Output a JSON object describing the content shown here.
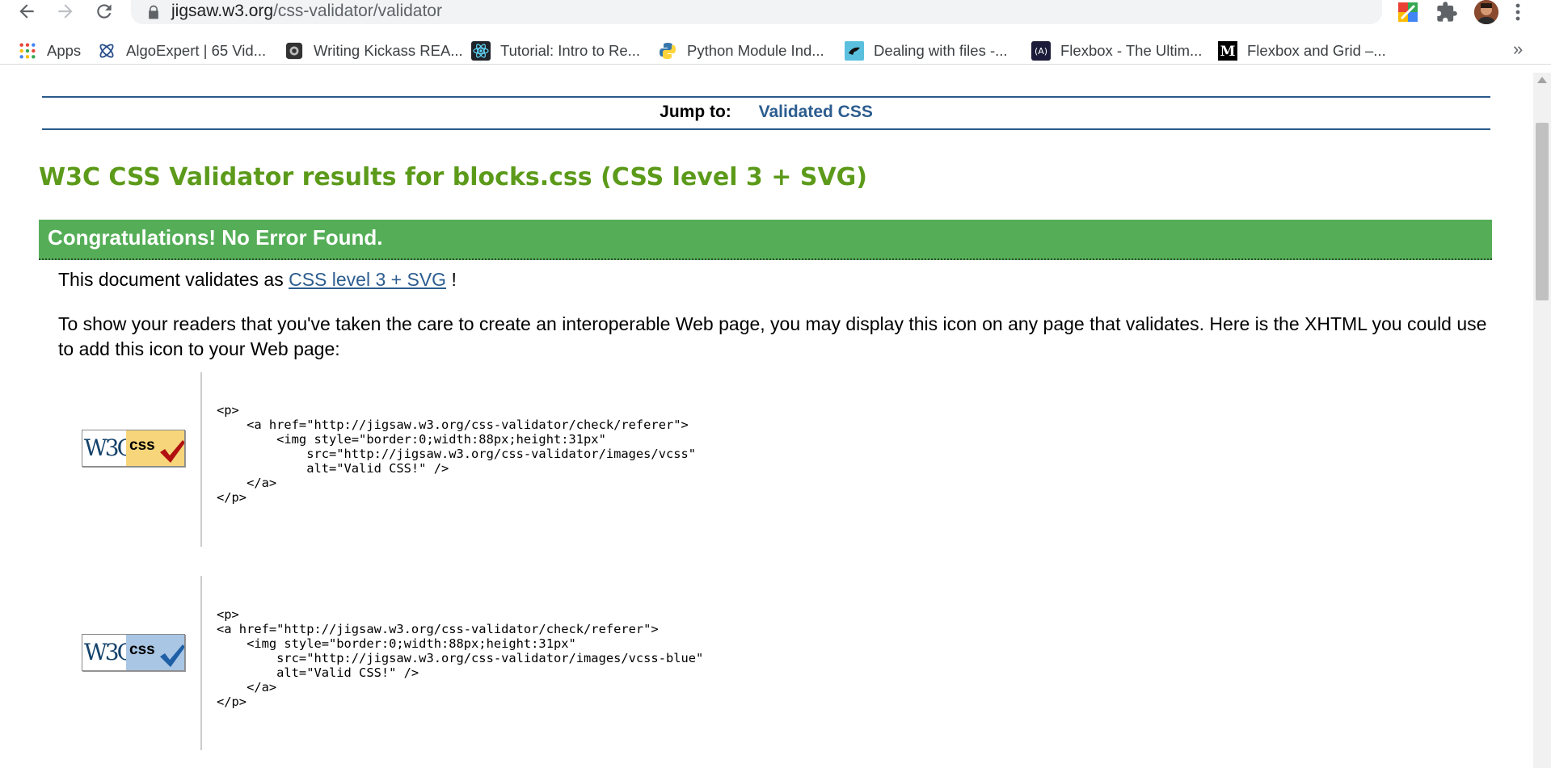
{
  "browser": {
    "url_host": "jigsaw.w3.org",
    "url_path": "/css-validator/validator"
  },
  "bookmarks": [
    {
      "label": "Apps",
      "icon": "apps-grid-icon"
    },
    {
      "label": "AlgoExpert | 65 Vid...",
      "icon": "algoexpert-icon"
    },
    {
      "label": "Writing Kickass REA...",
      "icon": "readme-site-icon"
    },
    {
      "label": "Tutorial: Intro to Re...",
      "icon": "react-icon"
    },
    {
      "label": "Python Module Ind...",
      "icon": "python-icon"
    },
    {
      "label": "Dealing with files -...",
      "icon": "file-site-icon"
    },
    {
      "label": "Flexbox - The Ultim...",
      "icon": "flexbox-site-icon"
    },
    {
      "label": "Flexbox and Grid –...",
      "icon": "medium-icon"
    }
  ],
  "page": {
    "jump_label": "Jump to:",
    "jump_link": "Validated CSS",
    "title": "W3C CSS Validator results for blocks.css (CSS level 3 + SVG)",
    "congrats": "Congratulations! No Error Found.",
    "validates_prefix": "This document validates as",
    "validates_link": "CSS level 3 + SVG",
    "validates_suffix": "!",
    "readers_text": "To show your readers that you've taken the care to create an interoperable Web page, you may display this icon on any page that validates. Here is the XHTML you could use to add this icon to your Web page:",
    "badges": [
      {
        "w3c": "W3C",
        "css": "css",
        "color": "#f7d57a",
        "tick_color": "#b01010",
        "code": "<p>\n    <a href=\"http://jigsaw.w3.org/css-validator/check/referer\">\n        <img style=\"border:0;width:88px;height:31px\"\n            src=\"http://jigsaw.w3.org/css-validator/images/vcss\"\n            alt=\"Valid CSS!\" />\n    </a>\n</p>"
      },
      {
        "w3c": "W3C",
        "css": "css",
        "color": "#a9c6e4",
        "tick_color": "#1f5fa6",
        "code": "<p>\n<a href=\"http://jigsaw.w3.org/css-validator/check/referer\">\n    <img style=\"border:0;width:88px;height:31px\"\n        src=\"http://jigsaw.w3.org/css-validator/images/vcss-blue\"\n        alt=\"Valid CSS!\" />\n    </a>\n</p>"
      }
    ]
  }
}
